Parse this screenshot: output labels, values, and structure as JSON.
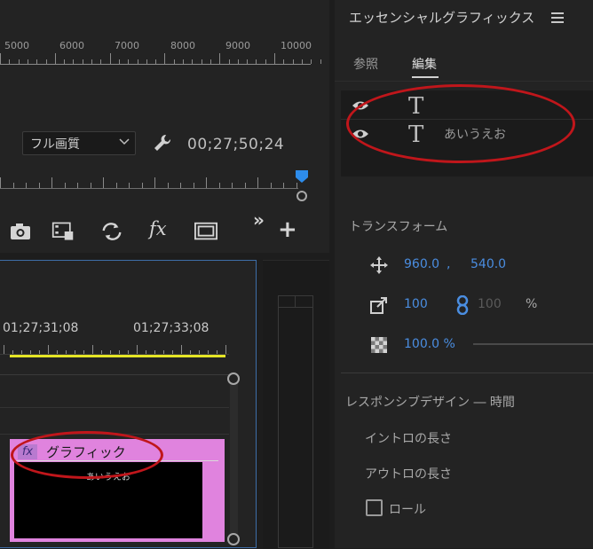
{
  "program_monitor": {
    "ruler_labels": [
      "5000",
      "6000",
      "7000",
      "8000",
      "9000",
      "10000"
    ],
    "quality": "フル画質",
    "timecode": "00;27;50;24",
    "controls": [
      "camera-icon",
      "export-frame-icon",
      "compare-icon",
      "fx-icon",
      "safe-margins-icon",
      "more-icon",
      "add-icon"
    ],
    "fx_glyph": "fx",
    "more_glyph": "»",
    "add_glyph": "+"
  },
  "timeline": {
    "times": [
      "01;27;31;08",
      "01;27;33;08"
    ],
    "clip": {
      "fx_label": "fx",
      "title": "グラフィック",
      "subtitle": "あいうえお",
      "color": "#e083de"
    }
  },
  "essential_graphics": {
    "title": "エッセンシャルグラフィックス",
    "tabs": {
      "browse": "参照",
      "edit": "編集"
    },
    "layers": [
      {
        "glyph": "T",
        "name": ""
      },
      {
        "glyph": "T",
        "name": "あいうえお"
      }
    ],
    "transform": {
      "label": "トランスフォーム",
      "position_x": "960.0",
      "position_y": "540.0",
      "comma": ",",
      "scale": "100",
      "scale_width": "100",
      "percent": "%",
      "opacity": "100.0 %"
    },
    "responsive": {
      "label": "レスポンシブデザイン ― 時間",
      "intro": "イントロの長さ",
      "outro": "アウトロの長さ",
      "roll": "ロール"
    }
  },
  "colors": {
    "accent_blue": "#4a8de0",
    "annotation_red": "#c0161b",
    "work_area_yellow": "#e5e526"
  }
}
